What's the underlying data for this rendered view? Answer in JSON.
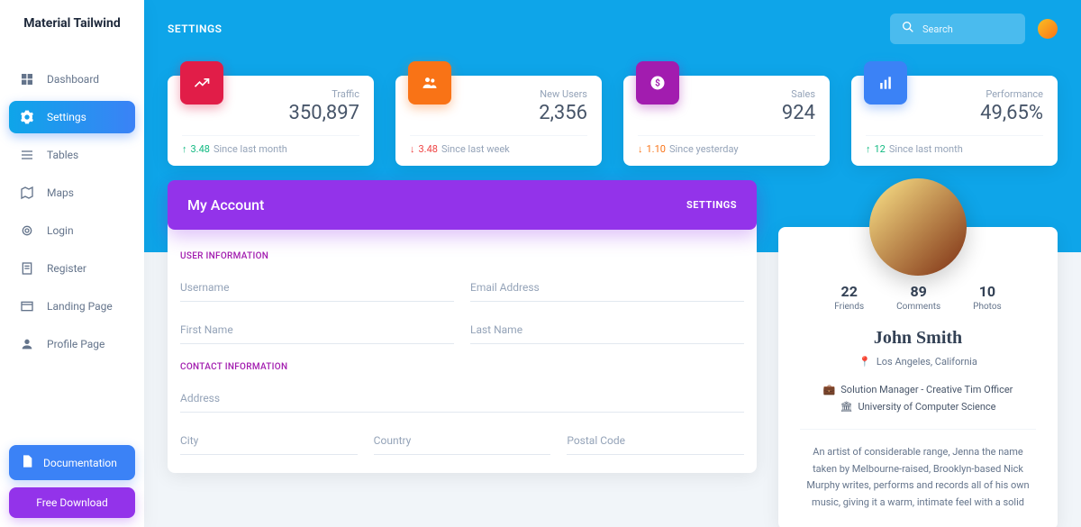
{
  "brand": "Material Tailwind",
  "nav": [
    {
      "icon": "dashboard",
      "label": "Dashboard"
    },
    {
      "icon": "settings",
      "label": "Settings"
    },
    {
      "icon": "table",
      "label": "Tables"
    },
    {
      "icon": "map",
      "label": "Maps"
    },
    {
      "icon": "fingerprint",
      "label": "Login"
    },
    {
      "icon": "clipboard",
      "label": "Register"
    },
    {
      "icon": "web",
      "label": "Landing Page"
    },
    {
      "icon": "person",
      "label": "Profile Page"
    }
  ],
  "bottom": {
    "doc": "Documentation",
    "dl": "Free Download"
  },
  "page": {
    "title": "SETTINGS",
    "search_placeholder": "Search"
  },
  "stats_cards": [
    {
      "label": "Traffic",
      "value": "350,897",
      "delta": "3.48",
      "dir": "up",
      "since": "Since last month",
      "color": "pink",
      "icon": "trend"
    },
    {
      "label": "New Users",
      "value": "2,356",
      "delta": "3.48",
      "dir": "down-red",
      "since": "Since last week",
      "color": "orange",
      "icon": "users"
    },
    {
      "label": "Sales",
      "value": "924",
      "delta": "1.10",
      "dir": "down-orange",
      "since": "Since yesterday",
      "color": "purple",
      "icon": "money"
    },
    {
      "label": "Performance",
      "value": "49,65%",
      "delta": "12",
      "dir": "up",
      "since": "Since last month",
      "color": "blue",
      "icon": "chart"
    }
  ],
  "account": {
    "title": "My Account",
    "btn": "SETTINGS",
    "sections": {
      "user_info": "USER INFORMATION",
      "contact_info": "CONTACT INFORMATION"
    },
    "fields": {
      "username": "Username",
      "email": "Email Address",
      "firstname": "First Name",
      "lastname": "Last Name",
      "address": "Address",
      "city": "City",
      "country": "Country",
      "postal": "Postal Code"
    }
  },
  "profile": {
    "stats": [
      {
        "num": "22",
        "label": "Friends"
      },
      {
        "num": "89",
        "label": "Comments"
      },
      {
        "num": "10",
        "label": "Photos"
      }
    ],
    "name": "John Smith",
    "location": "Los Angeles, California",
    "role": "Solution Manager - Creative Tim Officer",
    "edu": "University of Computer Science",
    "bio": "An artist of considerable range, Jenna the name taken by Melbourne-raised, Brooklyn-based Nick Murphy writes, performs and records all of his own music, giving it a warm, intimate feel with a solid"
  }
}
